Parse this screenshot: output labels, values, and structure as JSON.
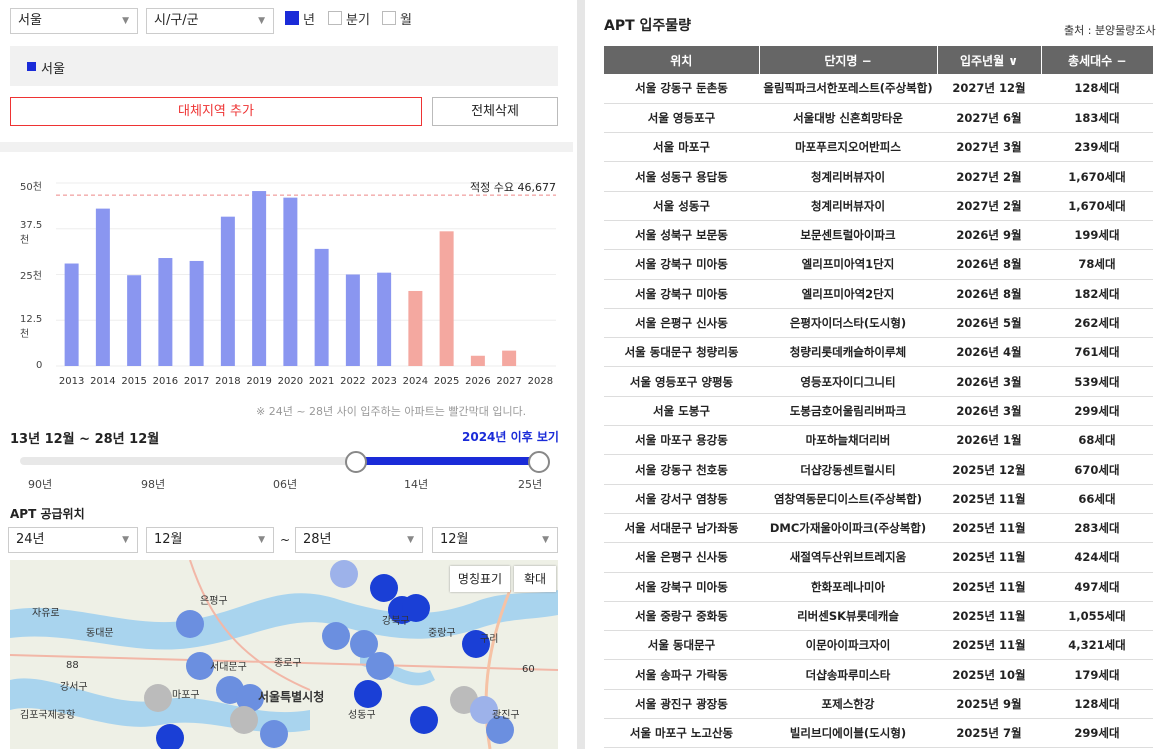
{
  "filters": {
    "region": "서울",
    "district": "시/구/군",
    "period_options": [
      {
        "label": "년",
        "checked": true
      },
      {
        "label": "분기",
        "checked": false
      },
      {
        "label": "월",
        "checked": false
      }
    ]
  },
  "selected_region": "서울",
  "buttons": {
    "add_region": "대체지역 추가",
    "delete_all": "전체삭제"
  },
  "chart_data": {
    "type": "bar",
    "categories": [
      "2013",
      "2014",
      "2015",
      "2016",
      "2017",
      "2018",
      "2019",
      "2020",
      "2021",
      "2022",
      "2023",
      "2024",
      "2025",
      "2026",
      "2027",
      "2028"
    ],
    "values": [
      28000,
      43000,
      24800,
      29500,
      28700,
      40800,
      47800,
      46000,
      32000,
      25000,
      25500,
      20500,
      36800,
      2800,
      4200,
      0
    ],
    "bar_colors": [
      "#8a96f0",
      "#8a96f0",
      "#8a96f0",
      "#8a96f0",
      "#8a96f0",
      "#8a96f0",
      "#8a96f0",
      "#8a96f0",
      "#8a96f0",
      "#8a96f0",
      "#8a96f0",
      "#f4a8a0",
      "#f4a8a0",
      "#f4a8a0",
      "#f4a8a0",
      "#f4a8a0"
    ],
    "ylim": [
      0,
      50000
    ],
    "yticks": [
      "0",
      "12.5천",
      "25천",
      "37.5천",
      "50천"
    ],
    "reference_line": {
      "value": 46677,
      "label": "적정 수요 46,677"
    },
    "title": "",
    "xlabel": "",
    "ylabel": ""
  },
  "chart_note": "※ 24년 ~ 28년 사이 입주하는 아파트는 빨간막대 입니다.",
  "range": {
    "label": "13년 12월 ~ 28년 12월",
    "link": "2024년 이후 보기",
    "ticks": [
      "90년",
      "98년",
      "06년",
      "14년",
      "25년"
    ]
  },
  "supply": {
    "title": "APT 공급위치",
    "from_year": "24년",
    "from_month": "12월",
    "tilde": "~",
    "to_year": "28년",
    "to_month": "12월"
  },
  "map": {
    "name_toggle": "명칭표기",
    "zoom": "확대",
    "labels": [
      "은평구",
      "자유로",
      "동대문",
      "강북구",
      "중랑구",
      "구리",
      "종로구",
      "서대문구",
      "마포구",
      "서울특별시청",
      "강서구",
      "김포국제공항",
      "성동구",
      "광진구",
      "88",
      "60"
    ]
  },
  "table": {
    "title": "APT 입주물량",
    "source": "출처 : 분양물량조사",
    "columns": [
      "위치",
      "단지명 −",
      "입주년월 ∨",
      "총세대수 −"
    ],
    "rows": [
      [
        "서울 강동구 둔촌동",
        "올림픽파크서한포레스트(주상복합)",
        "2027년 12월",
        "128세대"
      ],
      [
        "서울 영등포구",
        "서울대방 신혼희망타운",
        "2027년 6월",
        "183세대"
      ],
      [
        "서울 마포구",
        "마포푸르지오어반피스",
        "2027년 3월",
        "239세대"
      ],
      [
        "서울 성동구 용답동",
        "청계리버뷰자이",
        "2027년 2월",
        "1,670세대"
      ],
      [
        "서울 성동구",
        "청계리버뷰자이",
        "2027년 2월",
        "1,670세대"
      ],
      [
        "서울 성북구 보문동",
        "보문센트럴아이파크",
        "2026년 9월",
        "199세대"
      ],
      [
        "서울 강북구 미아동",
        "엘리프미아역1단지",
        "2026년 8월",
        "78세대"
      ],
      [
        "서울 강북구 미아동",
        "엘리프미아역2단지",
        "2026년 8월",
        "182세대"
      ],
      [
        "서울 은평구 신사동",
        "은평자이더스타(도시형)",
        "2026년 5월",
        "262세대"
      ],
      [
        "서울 동대문구 청량리동",
        "청량리롯데캐슬하이루체",
        "2026년 4월",
        "761세대"
      ],
      [
        "서울 영등포구 양평동",
        "영등포자이디그니티",
        "2026년 3월",
        "539세대"
      ],
      [
        "서울 도봉구",
        "도봉금호어울림리버파크",
        "2026년 3월",
        "299세대"
      ],
      [
        "서울 마포구 용강동",
        "마포하늘채더리버",
        "2026년 1월",
        "68세대"
      ],
      [
        "서울 강동구 천호동",
        "더샵강동센트럴시티",
        "2025년 12월",
        "670세대"
      ],
      [
        "서울 강서구 염창동",
        "염창역동문디이스트(주상복합)",
        "2025년 11월",
        "66세대"
      ],
      [
        "서울 서대문구 남가좌동",
        "DMC가재울아이파크(주상복합)",
        "2025년 11월",
        "283세대"
      ],
      [
        "서울 은평구 신사동",
        "새절역두산위브트레지움",
        "2025년 11월",
        "424세대"
      ],
      [
        "서울 강북구 미아동",
        "한화포레나미아",
        "2025년 11월",
        "497세대"
      ],
      [
        "서울 중랑구 중화동",
        "리버센SK뷰롯데캐슬",
        "2025년 11월",
        "1,055세대"
      ],
      [
        "서울 동대문구",
        "이문아이파크자이",
        "2025년 11월",
        "4,321세대"
      ],
      [
        "서울 송파구 가락동",
        "더샵송파루미스타",
        "2025년 10월",
        "179세대"
      ],
      [
        "서울 광진구 광장동",
        "포제스한강",
        "2025년 9월",
        "128세대"
      ],
      [
        "서울 마포구 노고산동",
        "빌리브디에이블(도시형)",
        "2025년 7월",
        "299세대"
      ]
    ]
  }
}
